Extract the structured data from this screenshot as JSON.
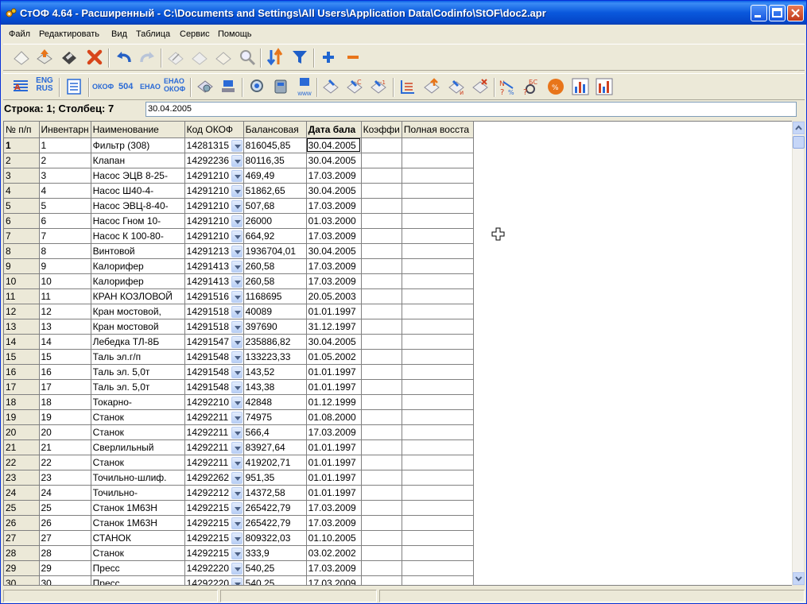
{
  "window": {
    "title": "СтОФ 4.64 - Расширенный - C:\\Documents and Settings\\All Users\\Application Data\\Codinfo\\StOF\\doc2.apr"
  },
  "menu": [
    "Файл",
    "Редактировать",
    "Вид",
    "Таблица",
    "Сервис",
    "Помощь"
  ],
  "toolbar1": [
    "new-doc-icon",
    "open-icon",
    "save-icon",
    "delete-icon",
    "undo-icon",
    "redo-icon",
    "cut-icon",
    "copy-icon",
    "paste-icon",
    "find-icon",
    "sort-icon",
    "filter-icon",
    "add-icon",
    "remove-icon"
  ],
  "toolbar2": {
    "eng_rus": [
      "ENG",
      "RUS"
    ],
    "okof": "ОКОФ",
    "code504": "504",
    "enao": "ЕНАО",
    "enao_okof": [
      "ЕНАО",
      "ОКОФ"
    ],
    "www": "www"
  },
  "position": {
    "label": "Строка: 1; Столбец: 7",
    "cell_value": "30.04.2005"
  },
  "table": {
    "columns": [
      "№ п/п",
      "Инвентарн",
      "Наименование",
      "Код ОКОФ",
      "Балансовая",
      "Дата бала",
      "Коэффи",
      "Полная восста"
    ],
    "rows": [
      [
        "1",
        "1",
        "Фильтр (308)",
        "14281315",
        "816045,85",
        "30.04.2005"
      ],
      [
        "2",
        "2",
        "Клапан",
        "14292236",
        "80116,35",
        "30.04.2005"
      ],
      [
        "3",
        "3",
        "Насос ЭЦВ 8-25-",
        "14291210",
        "469,49",
        "17.03.2009"
      ],
      [
        "4",
        "4",
        "Насос Ш40-4-",
        "14291210",
        "51862,65",
        "30.04.2005"
      ],
      [
        "5",
        "5",
        "Насос ЭВЦ-8-40-",
        "14291210",
        "507,68",
        "17.03.2009"
      ],
      [
        "6",
        "6",
        "Насос Гном 10-",
        "14291210",
        "26000",
        "01.03.2000"
      ],
      [
        "7",
        "7",
        "Насос К 100-80-",
        "14291210",
        "664,92",
        "17.03.2009"
      ],
      [
        "8",
        "8",
        "Винтовой",
        "14291213",
        "1936704,01",
        "30.04.2005"
      ],
      [
        "9",
        "9",
        "Калорифер",
        "14291413",
        "260,58",
        "17.03.2009"
      ],
      [
        "10",
        "10",
        "Калорифер",
        "14291413",
        "260,58",
        "17.03.2009"
      ],
      [
        "11",
        "11",
        "КРАН КОЗЛОВОЙ",
        "14291516",
        "1168695",
        "20.05.2003"
      ],
      [
        "12",
        "12",
        "Кран мостовой,",
        "14291518",
        "40089",
        "01.01.1997"
      ],
      [
        "13",
        "13",
        "Кран мостовой",
        "14291518",
        "397690",
        "31.12.1997"
      ],
      [
        "14",
        "14",
        "Лебедка ТЛ-8Б",
        "14291547",
        "235886,82",
        "30.04.2005"
      ],
      [
        "15",
        "15",
        "Таль эл.г/п",
        "14291548",
        "133223,33",
        "01.05.2002"
      ],
      [
        "16",
        "16",
        "Таль эл. 5,0т",
        "14291548",
        "143,52",
        "01.01.1997"
      ],
      [
        "17",
        "17",
        "Таль эл. 5,0т",
        "14291548",
        "143,38",
        "01.01.1997"
      ],
      [
        "18",
        "18",
        "Токарно-",
        "14292210",
        "42848",
        "01.12.1999"
      ],
      [
        "19",
        "19",
        "Станок",
        "14292211",
        "74975",
        "01.08.2000"
      ],
      [
        "20",
        "20",
        "Станок",
        "14292211",
        "566,4",
        "17.03.2009"
      ],
      [
        "21",
        "21",
        "Сверлильный",
        "14292211",
        "83927,64",
        "01.01.1997"
      ],
      [
        "22",
        "22",
        "Станок",
        "14292211",
        "419202,71",
        "01.01.1997"
      ],
      [
        "23",
        "23",
        "Точильно-шлиф.",
        "14292262",
        "951,35",
        "01.01.1997"
      ],
      [
        "24",
        "24",
        "Точильно-",
        "14292212",
        "14372,58",
        "01.01.1997"
      ],
      [
        "25",
        "25",
        "Станок 1М63Н",
        "14292215",
        "265422,79",
        "17.03.2009"
      ],
      [
        "26",
        "26",
        "Станок 1М63Н",
        "14292215",
        "265422,79",
        "17.03.2009"
      ],
      [
        "27",
        "27",
        "СТАНОК",
        "14292215",
        "809322,03",
        "01.10.2005"
      ],
      [
        "28",
        "28",
        "Станок",
        "14292215",
        "333,9",
        "03.02.2002"
      ],
      [
        "29",
        "29",
        "Пресс",
        "14292220",
        "540,25",
        "17.03.2009"
      ],
      [
        "30",
        "30",
        "Пресс",
        "14292220",
        "540,25",
        "17.03.2009"
      ]
    ]
  }
}
